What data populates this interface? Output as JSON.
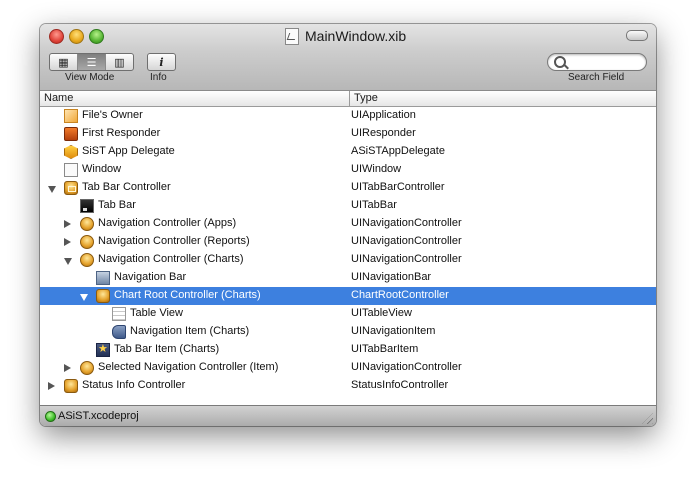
{
  "window": {
    "title": "MainWindow.xib"
  },
  "toolbar": {
    "view_mode_label": "View Mode",
    "view_modes": [
      {
        "icon": "icon-view-icon",
        "selected": false
      },
      {
        "icon": "list-view-icon",
        "selected": true
      },
      {
        "icon": "column-view-icon",
        "selected": false
      }
    ],
    "info_label": "Info",
    "info_glyph": "i",
    "search_label": "Search Field",
    "search_value": ""
  },
  "table": {
    "columns": [
      "Name",
      "Type"
    ],
    "rows": [
      {
        "name": "File's Owner",
        "type": "UIApplication",
        "icon": "cube-icon",
        "disclosure": "none",
        "indent": 0,
        "selected": false
      },
      {
        "name": "First Responder",
        "type": "UIResponder",
        "icon": "first-responder-icon",
        "disclosure": "none",
        "indent": 0,
        "selected": false
      },
      {
        "name": "SiST App Delegate",
        "type": "ASiSTAppDelegate",
        "icon": "object-icon",
        "disclosure": "none",
        "indent": 0,
        "selected": false
      },
      {
        "name": "Window",
        "type": "UIWindow",
        "icon": "window-icon",
        "disclosure": "none",
        "indent": 0,
        "selected": false
      },
      {
        "name": "Tab Bar Controller",
        "type": "UITabBarController",
        "icon": "tab-bar-controller-icon",
        "disclosure": "open",
        "indent": 0,
        "selected": false
      },
      {
        "name": "Tab Bar",
        "type": "UITabBar",
        "icon": "tab-bar-icon",
        "disclosure": "none",
        "indent": 1,
        "selected": false
      },
      {
        "name": "Navigation Controller (Apps)",
        "type": "UINavigationController",
        "icon": "navigation-controller-icon",
        "disclosure": "closed",
        "indent": 1,
        "selected": false
      },
      {
        "name": "Navigation Controller (Reports)",
        "type": "UINavigationController",
        "icon": "navigation-controller-icon",
        "disclosure": "closed",
        "indent": 1,
        "selected": false
      },
      {
        "name": "Navigation Controller (Charts)",
        "type": "UINavigationController",
        "icon": "navigation-controller-icon",
        "disclosure": "open",
        "indent": 1,
        "selected": false
      },
      {
        "name": "Navigation Bar",
        "type": "UINavigationBar",
        "icon": "navigation-bar-icon",
        "disclosure": "none",
        "indent": 2,
        "selected": false
      },
      {
        "name": "Chart Root Controller (Charts)",
        "type": "ChartRootController",
        "icon": "view-controller-icon",
        "disclosure": "open",
        "indent": 2,
        "selected": true
      },
      {
        "name": "Table View",
        "type": "UITableView",
        "icon": "table-view-icon",
        "disclosure": "none",
        "indent": 3,
        "selected": false
      },
      {
        "name": "Navigation Item (Charts)",
        "type": "UINavigationItem",
        "icon": "navigation-item-icon",
        "disclosure": "none",
        "indent": 3,
        "selected": false
      },
      {
        "name": "Tab Bar Item (Charts)",
        "type": "UITabBarItem",
        "icon": "tab-bar-item-icon",
        "disclosure": "none",
        "indent": 2,
        "selected": false
      },
      {
        "name": "Selected Navigation Controller (Item)",
        "type": "UINavigationController",
        "icon": "navigation-controller-icon",
        "disclosure": "closed",
        "indent": 1,
        "selected": false
      },
      {
        "name": "Status Info Controller",
        "type": "StatusInfoController",
        "icon": "view-controller-icon",
        "disclosure": "closed",
        "indent": 0,
        "selected": false
      }
    ]
  },
  "status": {
    "project": "ASiST.xcodeproj",
    "indicator_color": "#3fbf2a"
  },
  "colors": {
    "selection": "#3d80df"
  }
}
